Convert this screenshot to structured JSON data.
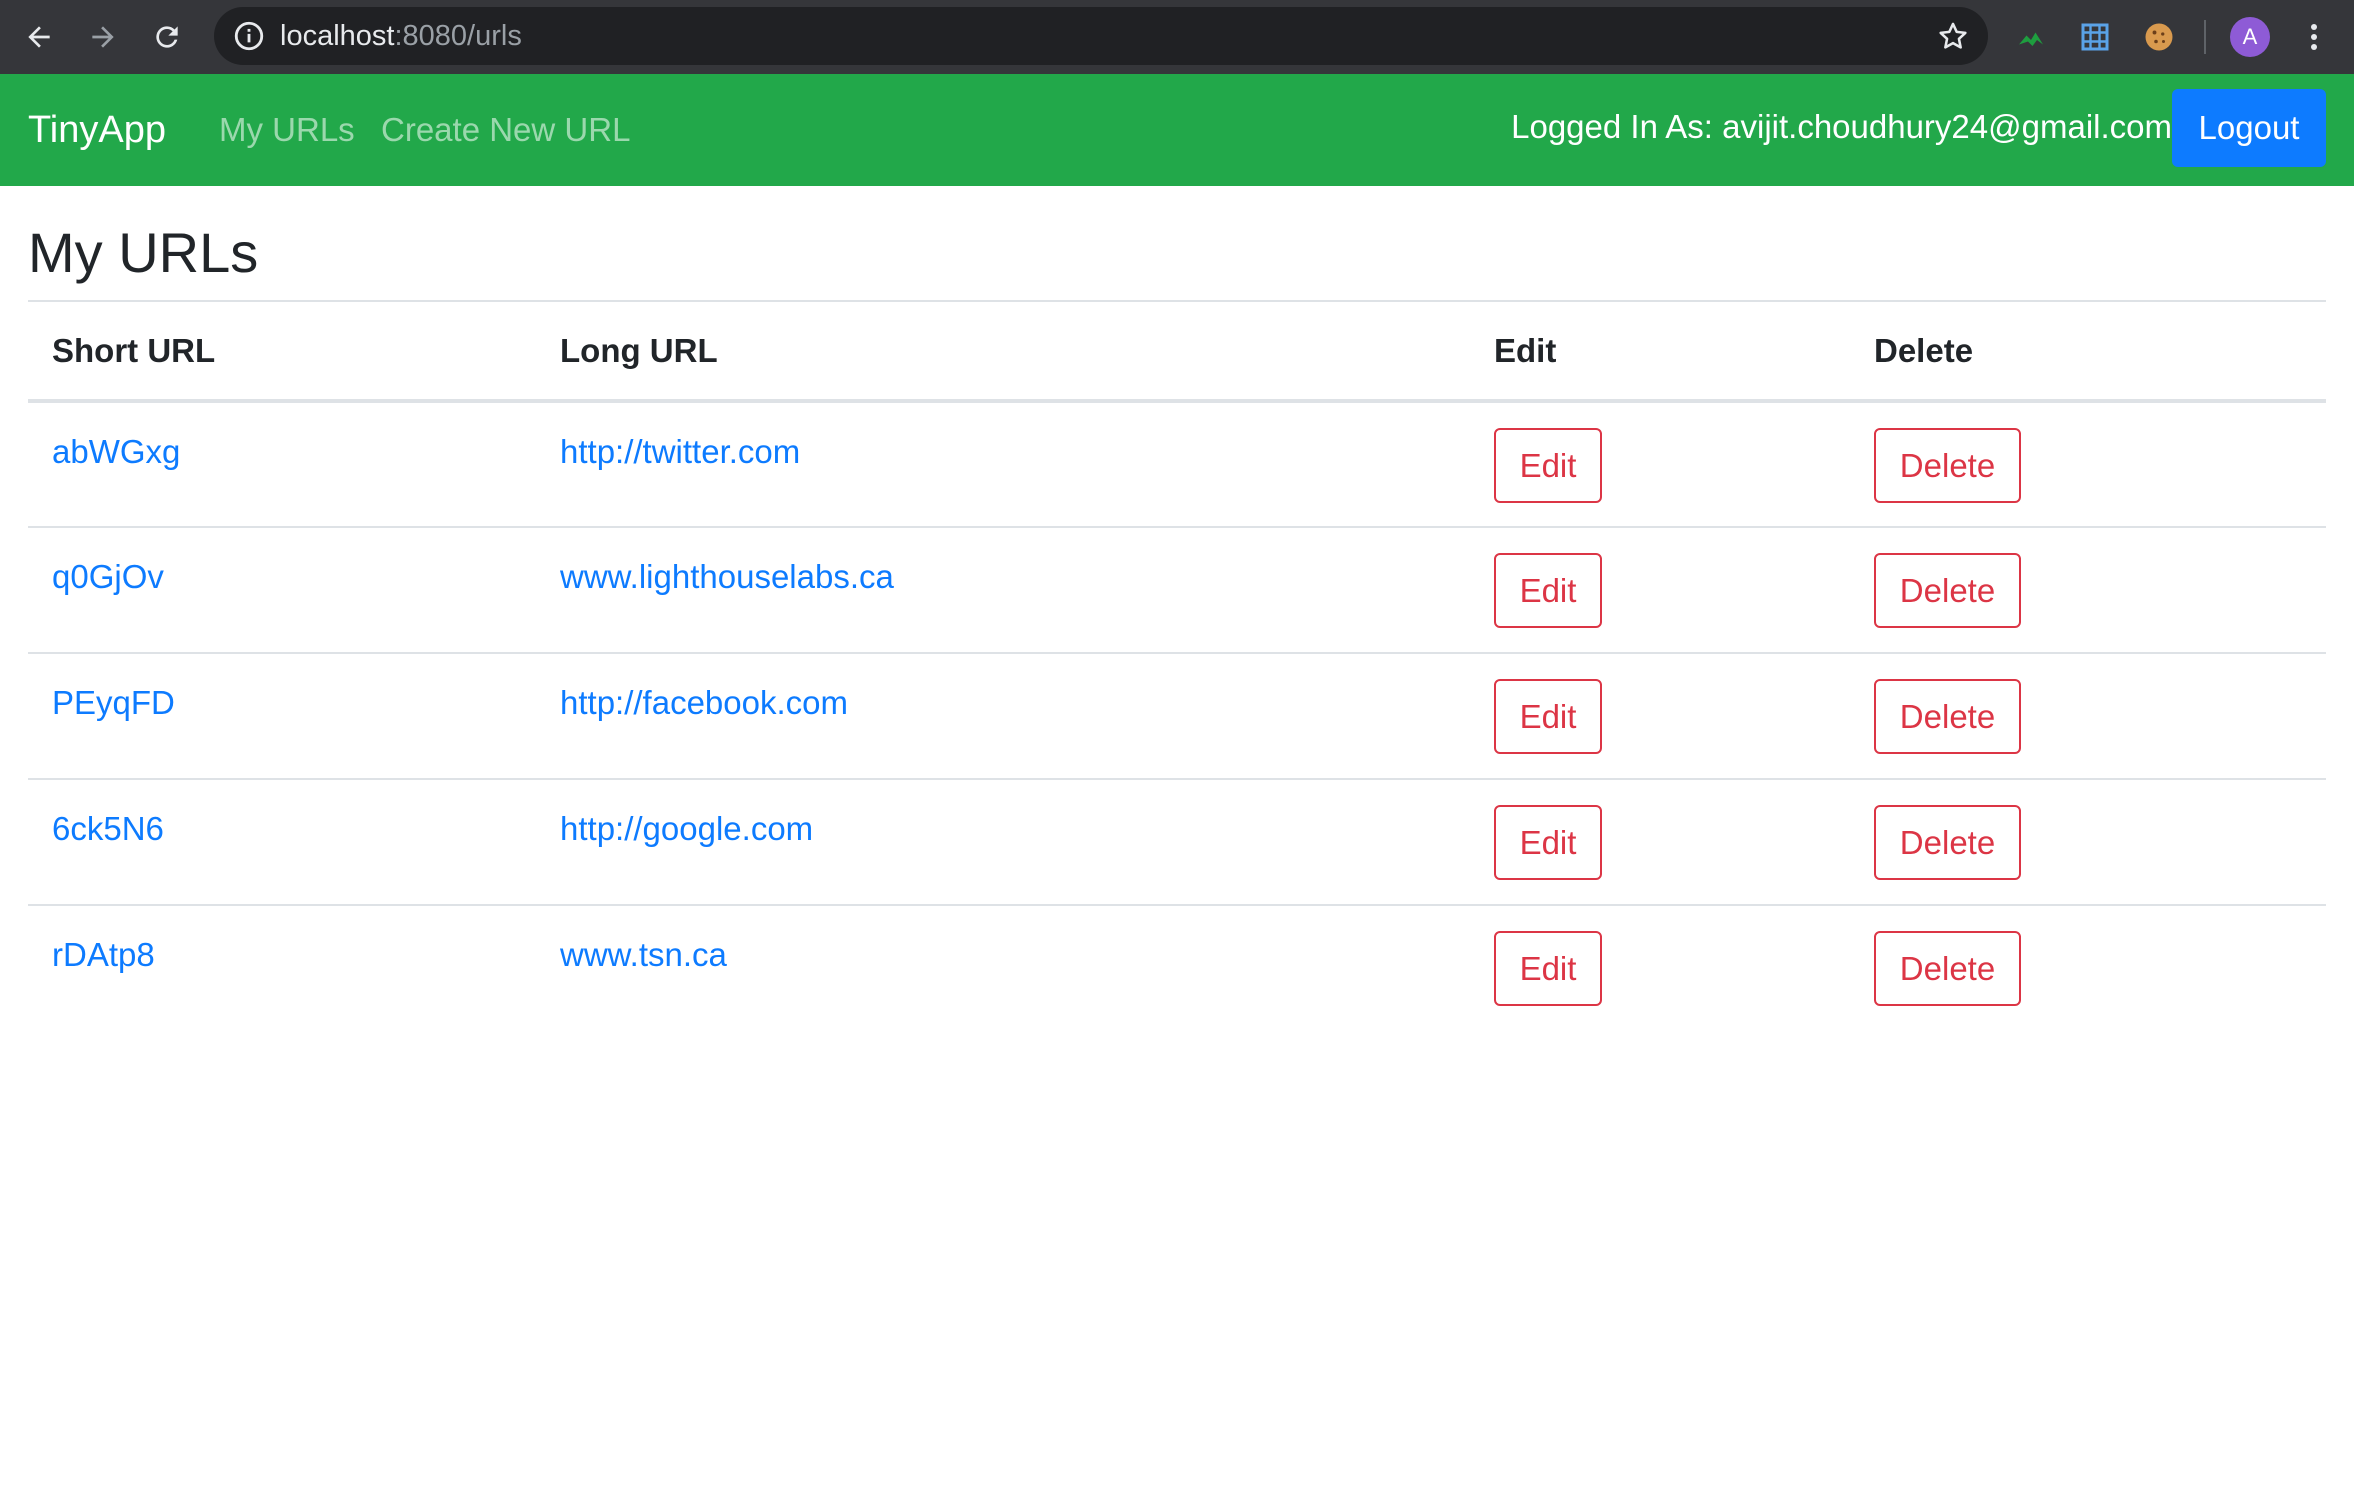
{
  "browser": {
    "url_host": "localhost",
    "url_path": ":8080/urls",
    "avatar_letter": "A"
  },
  "navbar": {
    "brand": "TinyApp",
    "links": [
      "My URLs",
      "Create New URL"
    ],
    "logged_in_label": "Logged In As: avijit.choudhury24@gmail.com",
    "logout_label": "Logout",
    "bg_color": "#22a84a",
    "logout_color": "#0d7bff"
  },
  "main": {
    "title": "My URLs",
    "columns": [
      "Short URL",
      "Long URL",
      "Edit",
      "Delete"
    ],
    "rows": [
      {
        "short": "abWGxg",
        "long": "http://twitter.com",
        "edit": "Edit",
        "delete": "Delete"
      },
      {
        "short": "q0GjOv",
        "long": "www.lighthouselabs.ca",
        "edit": "Edit",
        "delete": "Delete"
      },
      {
        "short": "PEyqFD",
        "long": "http://facebook.com",
        "edit": "Edit",
        "delete": "Delete"
      },
      {
        "short": "6ck5N6",
        "long": "http://google.com",
        "edit": "Edit",
        "delete": "Delete"
      },
      {
        "short": "rDAtp8",
        "long": "www.tsn.ca",
        "edit": "Edit",
        "delete": "Delete"
      }
    ]
  }
}
